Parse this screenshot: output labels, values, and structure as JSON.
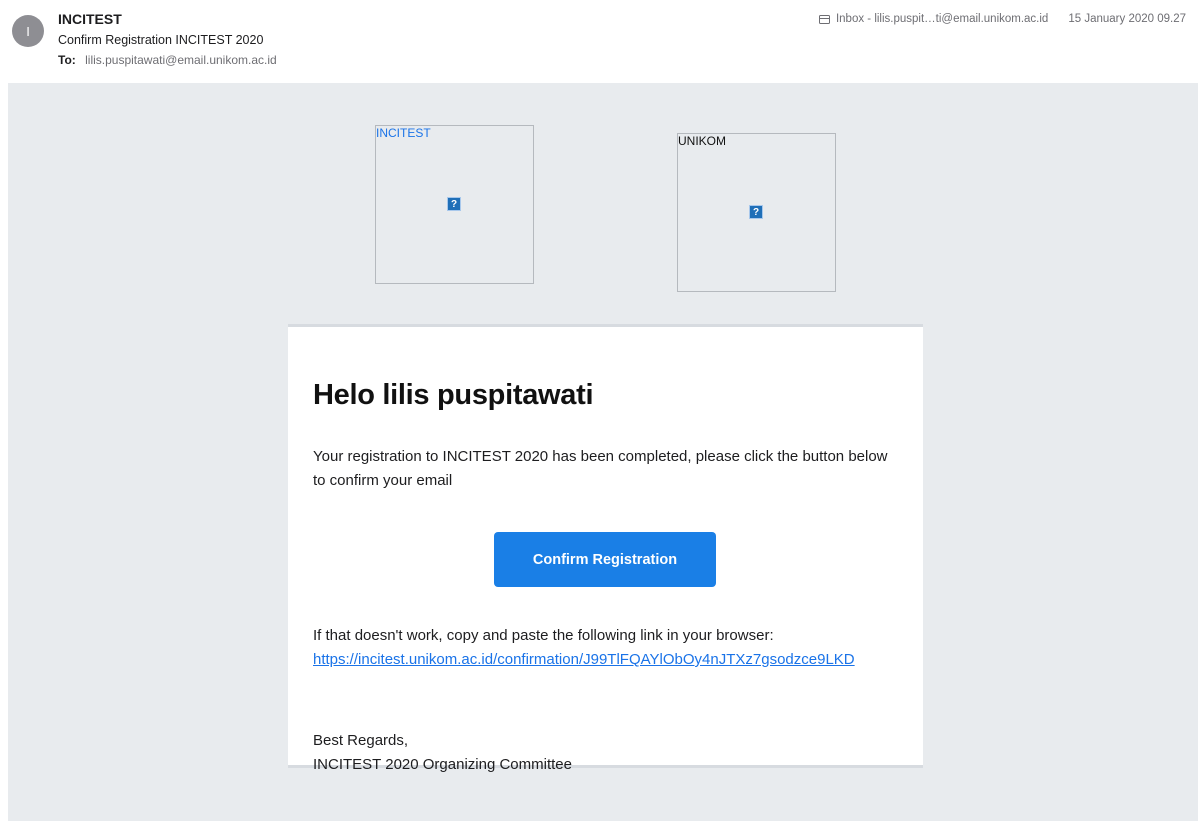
{
  "header": {
    "avatar_initial": "I",
    "sender": "INCITEST",
    "subject": "Confirm Registration INCITEST 2020",
    "to_label": "To:",
    "to_address": "lilis.puspitawati@email.unikom.ac.id",
    "mailbox": "Inbox - lilis.puspit…ti@email.unikom.ac.id",
    "date": "15 January 2020 09.27"
  },
  "logos": {
    "left_alt": "INCITEST",
    "right_alt": "UNIKOM",
    "broken_glyph": "?"
  },
  "card": {
    "greeting": "Helo lilis puspitawati",
    "intro": "Your registration to INCITEST 2020 has been completed, please click the button below to confirm your email",
    "button_label": "Confirm Registration",
    "fallback_text": "If that doesn't work, copy and paste the following link in your browser:",
    "link_text": "https://incitest.unikom.ac.id/confirmation/J99TlFQAYlObOy4nJTXz7gsodzce9LKD",
    "regards_line1": "Best Regards,",
    "regards_line2": "INCITEST 2020 Organizing Committee"
  },
  "icons": {
    "mailbox": "mailbox-icon",
    "broken_image": "broken-image-icon"
  },
  "colors": {
    "accent": "#1a7fe6",
    "link": "#1a73e8",
    "background": "#e8ebee"
  }
}
